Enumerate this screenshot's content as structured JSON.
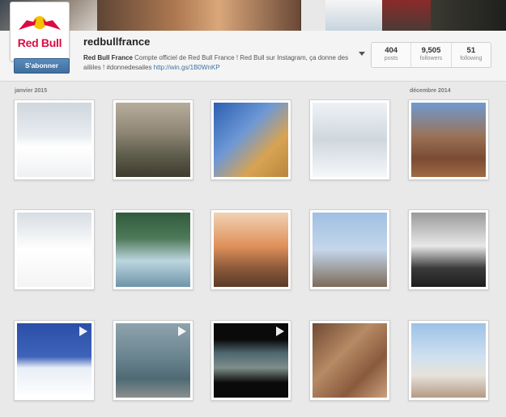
{
  "profile": {
    "username": "redbullfrance",
    "follow_label": "S'abonner",
    "bio_name": "Red Bull France",
    "bio_text": " Compte officiel de Red Bull France ! Red Bull sur Instagram, ça donne des ailiiles ! #donnedesailes ",
    "bio_link": "http://win.gs/1B0WnKP",
    "logo_text": "Red Bull"
  },
  "stats": [
    {
      "value": "404",
      "label": "posts"
    },
    {
      "value": "9,505",
      "label": "followers"
    },
    {
      "value": "51",
      "label": "following"
    }
  ],
  "dates": {
    "left": "janvier 2015",
    "right": "décembre 2014"
  },
  "colors": {
    "brand_red": "#db0a40",
    "link_blue": "#3f72a2",
    "button_blue": "#4a7aab"
  },
  "photos": [
    {
      "subject": "snow-park-redbull-can",
      "video": false
    },
    {
      "subject": "mountain-peaks-hiker",
      "video": false
    },
    {
      "subject": "skateboarder-ramp",
      "video": false
    },
    {
      "subject": "skier-snowy-trees",
      "video": false
    },
    {
      "subject": "cliff-jump-canyon",
      "video": false
    },
    {
      "subject": "santa-on-motorbike",
      "video": false
    },
    {
      "subject": "river-rapids-forest",
      "video": false
    },
    {
      "subject": "bmx-sunset-jump",
      "video": false
    },
    {
      "subject": "motocross-trick-tower",
      "video": false
    },
    {
      "subject": "iceberg-bw",
      "video": false
    },
    {
      "subject": "snow-dunes-blue-sky",
      "video": true
    },
    {
      "subject": "industrial-bmx",
      "video": true
    },
    {
      "subject": "beach-palm-street",
      "video": true
    },
    {
      "subject": "aerial-desert-canyons",
      "video": false
    },
    {
      "subject": "urban-ski-jump",
      "video": false
    }
  ]
}
